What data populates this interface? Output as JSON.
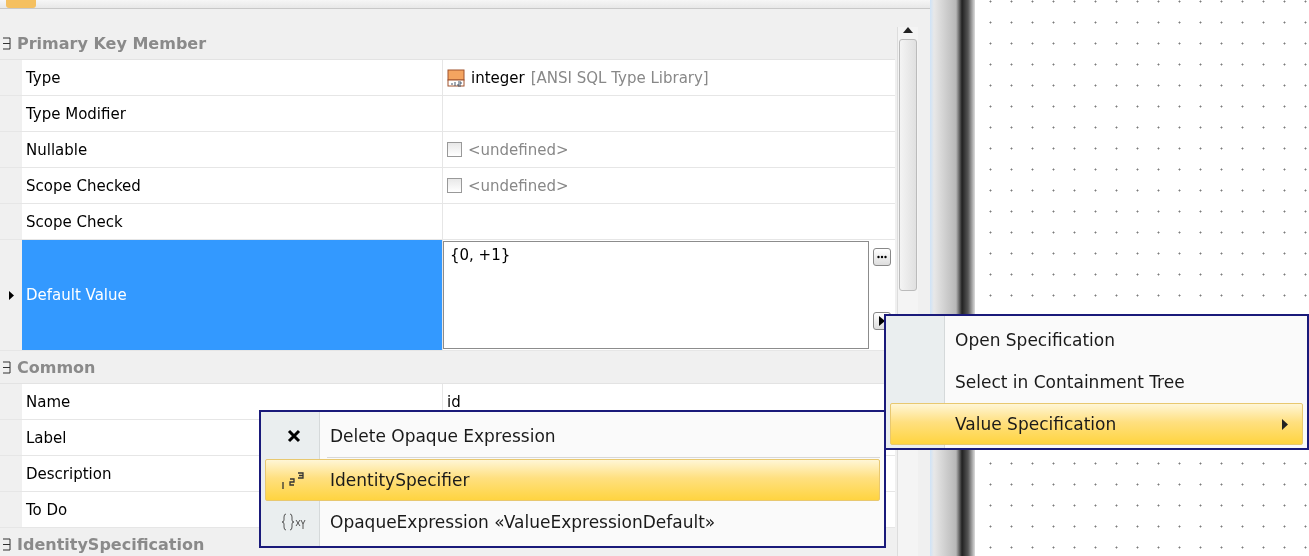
{
  "property_groups": [
    {
      "title": "Primary Key Member",
      "expanded": true,
      "rows": [
        {
          "label": "Type",
          "kind": "type",
          "value": "integer",
          "note": "[ANSI SQL Type Library]",
          "selected": false
        },
        {
          "label": "Type Modifier",
          "kind": "text",
          "selected": false
        },
        {
          "label": "Nullable",
          "kind": "checkbox",
          "checked": false,
          "value": "<undefined>",
          "selected": false
        },
        {
          "label": "Scope Checked",
          "kind": "checkbox",
          "checked": false,
          "value": "<undefined>",
          "selected": false
        },
        {
          "label": "Scope Check",
          "kind": "text",
          "selected": false
        },
        {
          "label": "Default Value",
          "kind": "expression",
          "value": "{0, +1}",
          "selected": true
        }
      ]
    },
    {
      "title": "Common",
      "expanded": true,
      "rows": [
        {
          "label": "Name",
          "kind": "text",
          "value": "id",
          "selected": false
        },
        {
          "label": "Label",
          "kind": "text",
          "selected": false
        },
        {
          "label": "Description",
          "kind": "text",
          "selected": false
        },
        {
          "label": "To Do",
          "kind": "text",
          "selected": false
        }
      ]
    },
    {
      "title": "IdentitySpecification",
      "expanded": true
    }
  ],
  "context_menu": {
    "items": [
      {
        "label": "Open Specification",
        "submenu": false,
        "selected": false
      },
      {
        "label": "Select in Containment Tree",
        "submenu": false,
        "selected": false
      },
      {
        "label": "Value Specification",
        "submenu": true,
        "selected": true
      }
    ]
  },
  "value_submenu": {
    "items": [
      {
        "label": "Delete Opaque Expression",
        "kind": "delete",
        "selected": false
      },
      {
        "label": "IdentitySpecifier",
        "kind": "number",
        "selected": true
      },
      {
        "label": "OpaqueExpression «ValueExpressionDefault»",
        "kind": "expression",
        "selected": false
      }
    ]
  }
}
